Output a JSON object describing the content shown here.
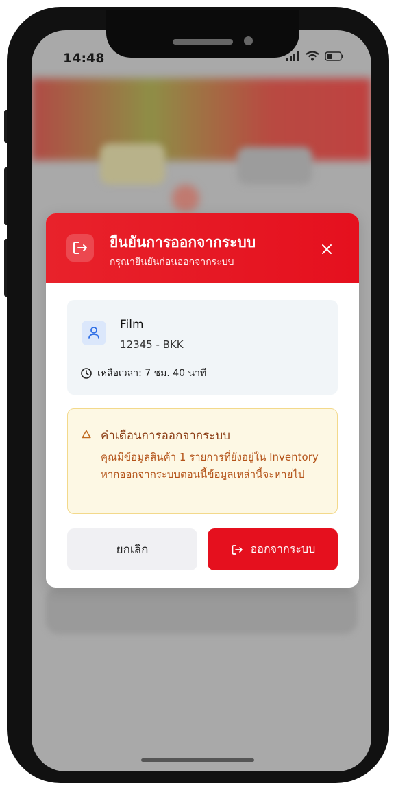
{
  "status_bar": {
    "time": "14:48"
  },
  "modal": {
    "title": "ยืนยันการออกจากระบบ",
    "subtitle": "กรุณายืนยันก่อนออกจากระบบ",
    "user": {
      "name": "Film",
      "code": "12345 - BKK",
      "time_left": "เหลือเวลา: 7 ชม. 40 นาที"
    },
    "warning": {
      "title": "คำเตือนการออกจากระบบ",
      "message": "คุณมีข้อมูลสินค้า 1 รายการที่ยังอยู่ใน Inventory หากออกจากระบบตอนนี้ข้อมูลเหล่านี้จะหายไป"
    },
    "buttons": {
      "cancel": "ยกเลิก",
      "logout": "ออกจากระบบ"
    }
  },
  "colors": {
    "primary": "#e5101e",
    "warning_bg": "#fdf8e4",
    "warning_text": "#b4541a",
    "warning_title": "#8a3b12",
    "card_bg": "#f1f5f8"
  },
  "icons": {
    "header": "logout-icon",
    "close": "close-icon",
    "user": "user-icon",
    "clock": "clock-icon",
    "warning": "warning-triangle-icon",
    "logout_button": "logout-icon"
  }
}
